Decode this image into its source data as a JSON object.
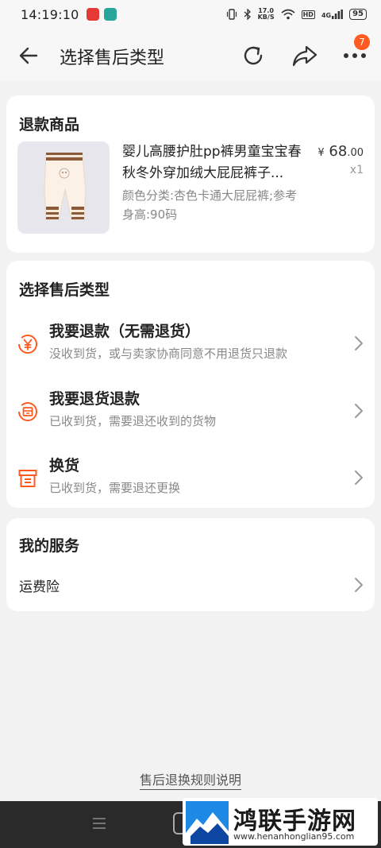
{
  "status_bar": {
    "time": "14:19:10",
    "net_speed_top": "17.0",
    "net_speed_bottom": "KB/S",
    "hd": "HD",
    "signal": "4G",
    "battery": "95"
  },
  "header": {
    "title": "选择售后类型",
    "badge_count": "7"
  },
  "product_section": {
    "title": "退款商品",
    "product": {
      "name": "婴儿高腰护肚pp裤男童宝宝春秋冬外穿加绒大屁屁裤子...",
      "spec": "颜色分类:杏色卡通大屁屁裤;参考身高:90码",
      "price_symbol": "¥",
      "price_int": "68",
      "price_dec": ".00",
      "quantity": "x1"
    }
  },
  "type_section": {
    "title": "选择售后类型",
    "options": [
      {
        "title": "我要退款（无需退货）",
        "desc": "没收到货，或与卖家协商同意不用退货只退款"
      },
      {
        "title": "我要退货退款",
        "desc": "已收到货，需要退还收到的货物"
      },
      {
        "title": "换货",
        "desc": "已收到货，需要退还更换"
      }
    ]
  },
  "service_section": {
    "title": "我的服务",
    "items": [
      {
        "label": "运费险"
      }
    ]
  },
  "rules_link": "售后退换规则说明",
  "watermark": {
    "title": "鸿联手游网",
    "url": "www.henanhonglian95.com"
  },
  "colors": {
    "accent": "#ff5a1f",
    "background": "#f2f2f2",
    "card": "#ffffff",
    "muted_text": "#888888"
  }
}
